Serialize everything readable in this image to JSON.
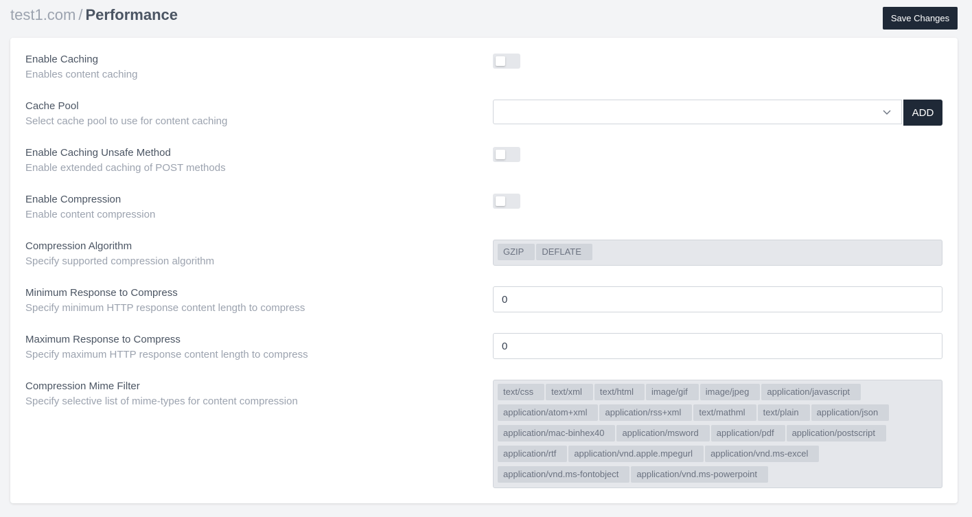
{
  "header": {
    "site": "test1.com",
    "separator": "/",
    "page": "Performance",
    "save_label": "Save Changes"
  },
  "settings": {
    "enable_caching": {
      "label": "Enable Caching",
      "desc": "Enables content caching",
      "enabled": false
    },
    "cache_pool": {
      "label": "Cache Pool",
      "desc": "Select cache pool to use for content caching",
      "value": "",
      "add_label": "ADD"
    },
    "unsafe_method": {
      "label": "Enable Caching Unsafe Method",
      "desc": "Enable extended caching of POST methods",
      "enabled": false
    },
    "compression": {
      "label": "Enable Compression",
      "desc": "Enable content compression",
      "enabled": false
    },
    "algorithm": {
      "label": "Compression Algorithm",
      "desc": "Specify supported compression algorithm",
      "tags": [
        "GZIP",
        "DEFLATE"
      ]
    },
    "min_response": {
      "label": "Minimum Response to Compress",
      "desc": "Specify minimum HTTP response content length to compress",
      "value": "0"
    },
    "max_response": {
      "label": "Maximum Response to Compress",
      "desc": "Specify maximum HTTP response content length to compress",
      "value": "0"
    },
    "mime_filter": {
      "label": "Compression Mime Filter",
      "desc": "Specify selective list of mime-types for content compression",
      "tags": [
        "text/css",
        "text/xml",
        "text/html",
        "image/gif",
        "image/jpeg",
        "application/javascript",
        "application/atom+xml",
        "application/rss+xml",
        "text/mathml",
        "text/plain",
        "application/json",
        "application/mac-binhex40",
        "application/msword",
        "application/pdf",
        "application/postscript",
        "application/rtf",
        "application/vnd.apple.mpegurl",
        "application/vnd.ms-excel",
        "application/vnd.ms-fontobject",
        "application/vnd.ms-powerpoint"
      ]
    }
  },
  "icons": {
    "select_arrow": "chevron-down-icon"
  },
  "colors": {
    "primary_button": "#1f2937",
    "page_bg": "#f3f4f6"
  }
}
